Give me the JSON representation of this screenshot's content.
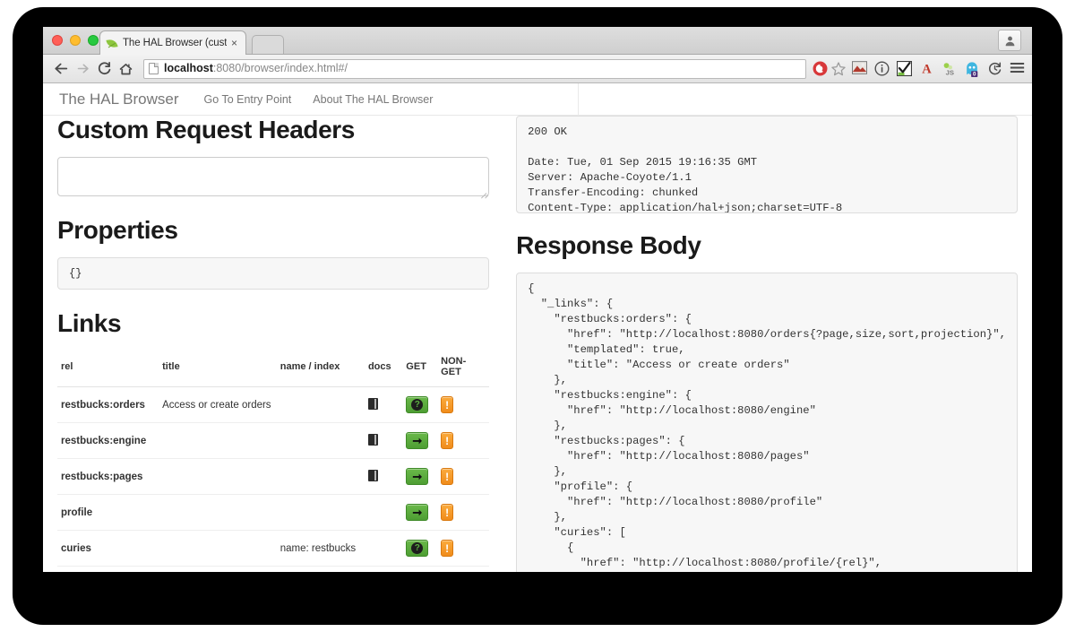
{
  "browser": {
    "tab": {
      "title": "The HAL Browser (customi",
      "favicon": "leaf-icon",
      "close": "×"
    },
    "new_tab_label": "",
    "nav": {
      "back": "←",
      "forward": "→",
      "reload": "⟳",
      "home": "⌂"
    },
    "url": {
      "host": "localhost",
      "rest": ":8080/browser/index.html#/",
      "full": "localhost:8080/browser/index.html#/"
    },
    "toolbar_icons": [
      "adblock-icon",
      "bookmark-star-icon",
      "screenshot-icon",
      "info-icon",
      "checkmark-icon",
      "font-a-icon",
      "javascript-icon",
      "ghostery-icon",
      "history-refresh-icon",
      "menu-icon"
    ],
    "ghostery_badge": "0",
    "profile_icon": "person-icon"
  },
  "site_nav": {
    "brand": "The HAL Browser",
    "links": [
      {
        "label": "Go To Entry Point"
      },
      {
        "label": "About The HAL Browser"
      }
    ]
  },
  "left_panel": {
    "custom_request_headers": {
      "heading": "Custom Request Headers",
      "value": "",
      "placeholder": ""
    },
    "properties": {
      "heading": "Properties",
      "value": "{}"
    },
    "links": {
      "heading": "Links",
      "columns": [
        "rel",
        "title",
        "name / index",
        "docs",
        "GET",
        "NON-GET"
      ],
      "rows": [
        {
          "rel": "restbucks:orders",
          "title": "Access or create orders",
          "name": "",
          "docs": "book-icon",
          "get": "question-button",
          "nonget": "!"
        },
        {
          "rel": "restbucks:engine",
          "title": "",
          "name": "",
          "docs": "book-icon",
          "get": "arrow-button",
          "nonget": "!"
        },
        {
          "rel": "restbucks:pages",
          "title": "",
          "name": "",
          "docs": "book-icon",
          "get": "arrow-button",
          "nonget": "!"
        },
        {
          "rel": "profile",
          "title": "",
          "name": "",
          "docs": "",
          "get": "arrow-button",
          "nonget": "!"
        },
        {
          "rel": "curies",
          "title": "",
          "name": "name: restbucks",
          "docs": "",
          "get": "question-button",
          "nonget": "!"
        }
      ]
    }
  },
  "right_panel": {
    "response_headers": "200 OK\n\nDate: Tue, 01 Sep 2015 19:16:35 GMT\nServer: Apache-Coyote/1.1\nTransfer-Encoding: chunked\nContent-Type: application/hal+json;charset=UTF-8",
    "response_body_heading": "Response Body",
    "response_body": "{\n  \"_links\": {\n    \"restbucks:orders\": {\n      \"href\": \"http://localhost:8080/orders{?page,size,sort,projection}\",\n      \"templated\": true,\n      \"title\": \"Access or create orders\"\n    },\n    \"restbucks:engine\": {\n      \"href\": \"http://localhost:8080/engine\"\n    },\n    \"restbucks:pages\": {\n      \"href\": \"http://localhost:8080/pages\"\n    },\n    \"profile\": {\n      \"href\": \"http://localhost:8080/profile\"\n    },\n    \"curies\": [\n      {\n        \"href\": \"http://localhost:8080/profile/{rel}\",\n        \"name\": \"restbucks\""
  },
  "colors": {
    "get_button": "#4e9e33",
    "nonget_button": "#f08c1b",
    "brand_text": "#777777",
    "heading": "#1a1a1a",
    "code_bg": "#f7f7f7"
  }
}
